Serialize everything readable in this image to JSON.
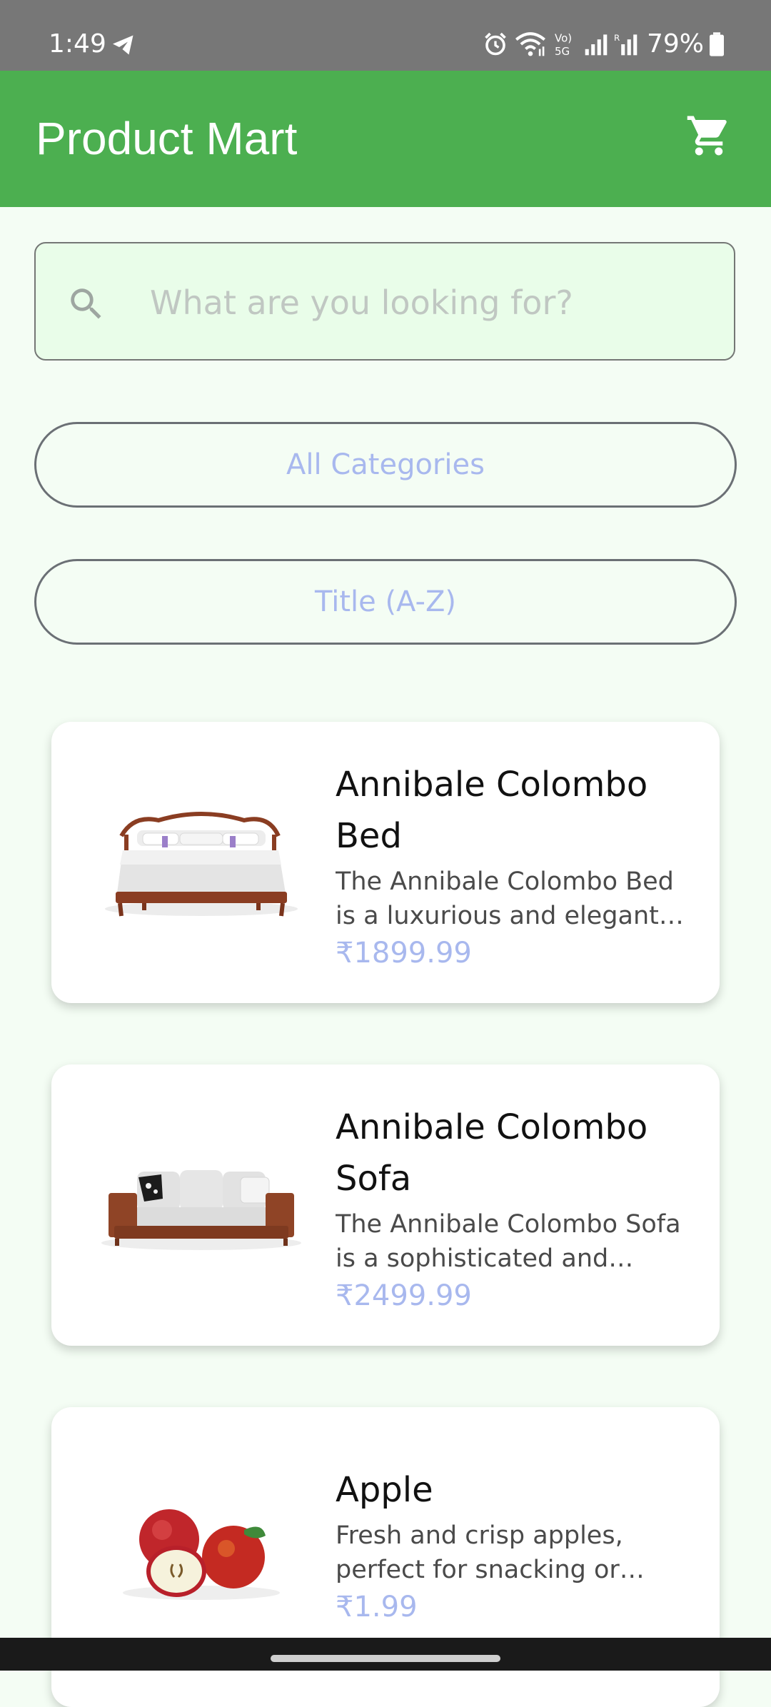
{
  "status_bar": {
    "time": "1:49",
    "battery": "79%",
    "icons": [
      "telegram-icon",
      "alarm-icon",
      "wifi-icon",
      "volte-icon",
      "signal-icon",
      "signal-roaming-icon",
      "battery-icon"
    ]
  },
  "app_bar": {
    "title": "Product Mart",
    "cart_icon": "shopping-cart-icon",
    "color": "#4caf50"
  },
  "search": {
    "placeholder": "What are you looking for?",
    "value": "",
    "icon": "search-icon"
  },
  "filters": {
    "category": "All Categories",
    "sort": "Title (A-Z)"
  },
  "products": [
    {
      "title": "Annibale Colombo Bed",
      "description": "The Annibale Colombo Bed is a luxurious and elegant bed frame, crafted with high-quality materials for a comfortable and stylish bedroom.",
      "price": "₹1899.99",
      "image": "bed-image"
    },
    {
      "title": "Annibale Colombo Sofa",
      "description": "The Annibale Colombo Sofa is a sophisticated and comfortable seating option, featuring exquisite design and premium upholstery.",
      "price": "₹2499.99",
      "image": "sofa-image"
    },
    {
      "title": "Apple",
      "description": "Fresh and crisp apples, perfect for snacking or incorporating into various recipes.",
      "price": "₹1.99",
      "image": "apple-image"
    }
  ],
  "colors": {
    "accent": "#4caf50",
    "price": "#a8b8ee",
    "background": "#f4fdf4"
  }
}
